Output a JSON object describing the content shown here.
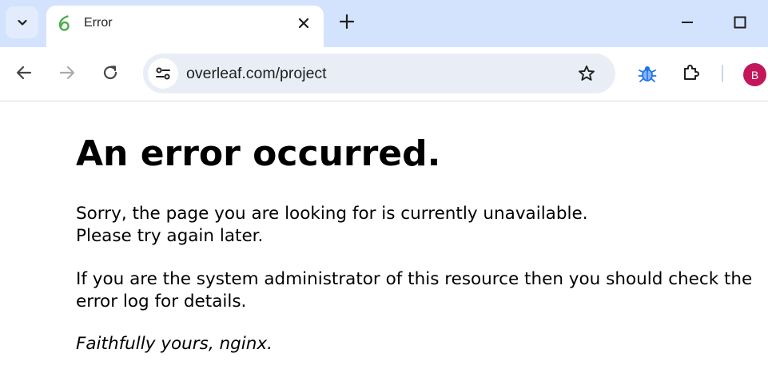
{
  "browser": {
    "tab": {
      "title": "Error"
    },
    "url": "overleaf.com/project",
    "profile_initial": "B",
    "colors": {
      "tabstrip": "#d3e3fd",
      "omnibox": "#e9eef6",
      "avatar": "#c2185b",
      "favicon": "#4cae4f",
      "extension_bug": "#1a73e8"
    },
    "icons": {
      "tab_search": "chevron-down-icon",
      "favicon": "overleaf-leaf-icon",
      "tab_close": "close-icon",
      "new_tab": "plus-icon",
      "minimize": "minimize-icon",
      "maximize": "maximize-icon",
      "back": "arrow-left-icon",
      "forward": "arrow-right-icon",
      "reload": "reload-icon",
      "site_info": "tune-icon",
      "bookmark": "star-icon",
      "extension": "bug-icon",
      "extensions_menu": "puzzle-icon"
    }
  },
  "page": {
    "heading": "An error occurred.",
    "paragraph1": {
      "line1": "Sorry, the page you are looking for is currently unavailable.",
      "line2": "Please try again later."
    },
    "paragraph2": {
      "line1": "If you are the system administrator of this resource then you should check the",
      "line2": "error log for details."
    },
    "signature": "Faithfully yours, nginx."
  }
}
